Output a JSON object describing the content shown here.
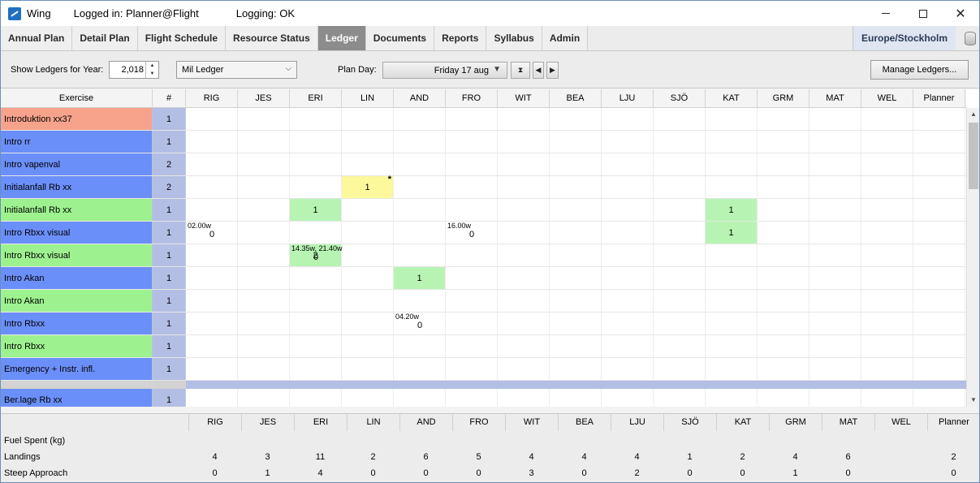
{
  "window": {
    "app": "Wing",
    "login": "Logged in: Planner@Flight",
    "logging": "Logging: OK"
  },
  "tabs": [
    {
      "label": "Annual Plan"
    },
    {
      "label": "Detail Plan"
    },
    {
      "label": "Flight Schedule"
    },
    {
      "label": "Resource Status"
    },
    {
      "label": "Ledger",
      "active": true
    },
    {
      "label": "Documents"
    },
    {
      "label": "Reports"
    },
    {
      "label": "Syllabus"
    },
    {
      "label": "Admin"
    }
  ],
  "timezone": "Europe/Stockholm",
  "toolbar": {
    "year_label": "Show Ledgers for Year:",
    "year_value": "2,018",
    "ledger_select": "Mil Ledger",
    "planday_label": "Plan Day:",
    "planday_value": "Friday 17 aug",
    "manage_label": "Manage Ledgers..."
  },
  "columns": [
    "RIG",
    "JES",
    "ERI",
    "LIN",
    "AND",
    "FRO",
    "WIT",
    "BEA",
    "LJU",
    "SJÖ",
    "KAT",
    "GRM",
    "MAT",
    "WEL",
    "Planner"
  ],
  "grid_header": {
    "exercise": "Exercise",
    "count": "#"
  },
  "colors": {
    "salmon": "#f7a38b",
    "blue": "#6b8ff8",
    "green": "#9df28f",
    "cell_green": "#b7f4b3",
    "cell_yellow": "#fbf99c",
    "count_bg": "#b3bee4"
  },
  "rows": [
    {
      "exercise": "Introduktion xx37",
      "count": "1",
      "color": "salmon",
      "cells": {}
    },
    {
      "exercise": "Intro rr",
      "count": "1",
      "color": "blue",
      "cells": {}
    },
    {
      "exercise": "Intro vapenval",
      "count": "2",
      "color": "blue",
      "cells": {}
    },
    {
      "exercise": "Initialanfall Rb xx",
      "count": "2",
      "color": "blue",
      "cells": {
        "LIN": {
          "value": "1",
          "bg": "cell_yellow",
          "star": "*"
        }
      }
    },
    {
      "exercise": "Initialanfall Rb xx",
      "count": "1",
      "color": "green",
      "cells": {
        "RIG": {
          "note": "02.00w",
          "sub": "0"
        },
        "ERI": {
          "value": "1",
          "bg": "cell_green"
        },
        "FRO": {
          "note": "16.00w",
          "sub": "0"
        },
        "KAT": {
          "value": "1",
          "bg": "cell_green"
        }
      }
    },
    {
      "exercise": "Intro Rbxx visual",
      "count": "1",
      "color": "blue",
      "cells": {
        "ERI": {
          "note": "14.35w, 21.40w",
          "sub": "0"
        },
        "KAT": {
          "value": "1",
          "bg": "cell_green"
        }
      }
    },
    {
      "exercise": "Intro Rbxx visual",
      "count": "1",
      "color": "green",
      "cells": {
        "ERI": {
          "value": "2",
          "bg": "cell_green"
        }
      }
    },
    {
      "exercise": "Intro Akan",
      "count": "1",
      "color": "blue",
      "cells": {
        "AND": {
          "value": "1",
          "bg": "cell_green"
        }
      }
    },
    {
      "exercise": "Intro Akan",
      "count": "1",
      "color": "green",
      "cells": {
        "AND": {
          "note": "04.20w",
          "sub": "0"
        }
      }
    },
    {
      "exercise": "Intro Rbxx",
      "count": "1",
      "color": "blue",
      "cells": {}
    },
    {
      "exercise": "Intro Rbxx",
      "count": "1",
      "color": "green",
      "cells": {}
    },
    {
      "exercise": "Emergency + Instr. infl.",
      "count": "1",
      "color": "blue",
      "cells": {}
    },
    {
      "exercise": "Ber.lage Rb xx",
      "count": "1",
      "color": "blue",
      "cells": {},
      "after_separator": true
    }
  ],
  "summary": {
    "rows": [
      {
        "label": "Fuel Spent (kg)",
        "values": [
          "",
          "",
          "",
          "",
          "",
          "",
          "",
          "",
          "",
          "",
          "",
          "",
          "",
          "",
          ""
        ]
      },
      {
        "label": "Landings",
        "values": [
          "4",
          "3",
          "11",
          "2",
          "6",
          "5",
          "4",
          "4",
          "4",
          "1",
          "2",
          "4",
          "6",
          "",
          "2"
        ]
      },
      {
        "label": "Steep Approach",
        "values": [
          "0",
          "1",
          "4",
          "0",
          "0",
          "0",
          "3",
          "0",
          "2",
          "0",
          "0",
          "1",
          "0",
          "",
          "0"
        ]
      }
    ]
  }
}
